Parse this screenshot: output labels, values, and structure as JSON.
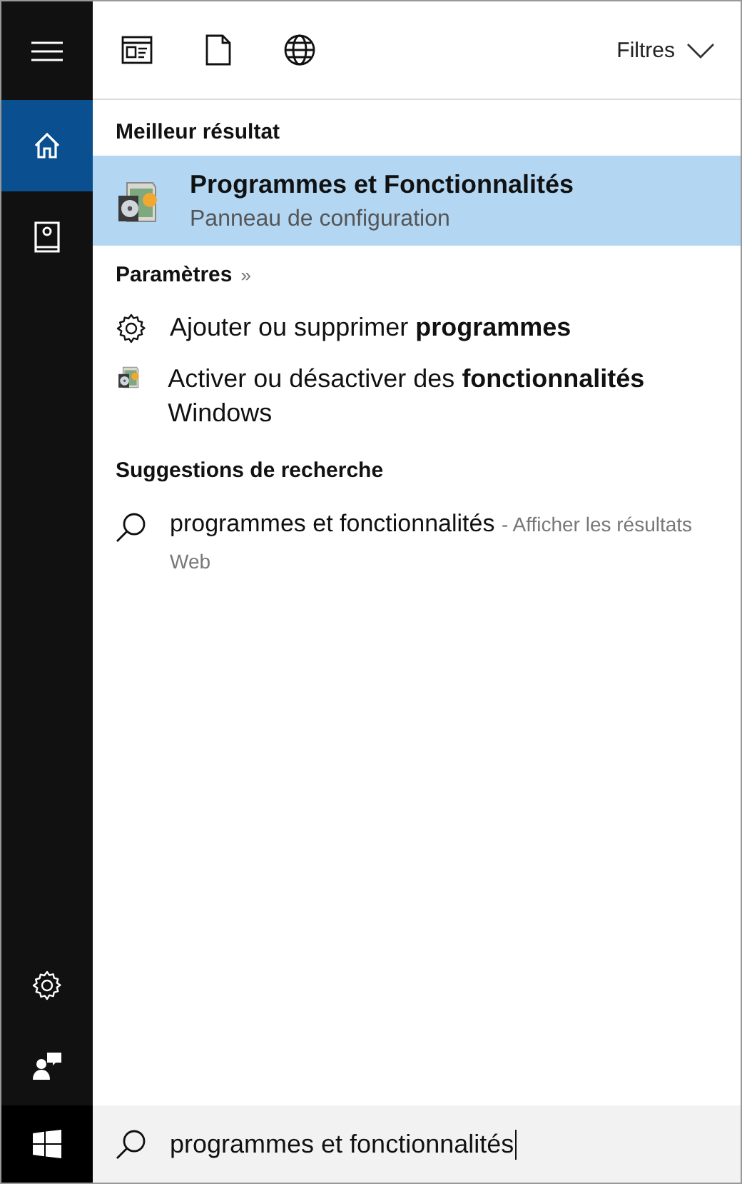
{
  "sidebar": {
    "top_items": [
      {
        "kind": "menu",
        "selected": false
      },
      {
        "kind": "home",
        "selected": true
      },
      {
        "kind": "notebook",
        "selected": false
      }
    ],
    "bottom_items": [
      {
        "kind": "settings",
        "selected": false
      },
      {
        "kind": "feedback",
        "selected": false
      }
    ]
  },
  "toolbar": {
    "filters": [
      {
        "kind": "apps"
      },
      {
        "kind": "documents"
      },
      {
        "kind": "web"
      }
    ],
    "filter_label": "Filtres"
  },
  "best_result": {
    "heading": "Meilleur résultat",
    "title": "Programmes et Fonctionnalités",
    "subtitle": "Panneau de configuration",
    "selected": true
  },
  "settings": {
    "heading": "Paramètres",
    "more": "»",
    "items": [
      {
        "kind": "gear",
        "text": "Ajouter ou supprimer **programmes**"
      },
      {
        "kind": "program",
        "text": "Activer ou désactiver des **fonctionnalités** Windows"
      }
    ]
  },
  "suggestions": {
    "heading": "Suggestions de recherche",
    "items": [
      {
        "text": "programmes et fonctionnalités",
        "hint": "- Afficher les résultats Web"
      }
    ]
  },
  "search_box": {
    "value": "programmes et fonctionnalités"
  }
}
